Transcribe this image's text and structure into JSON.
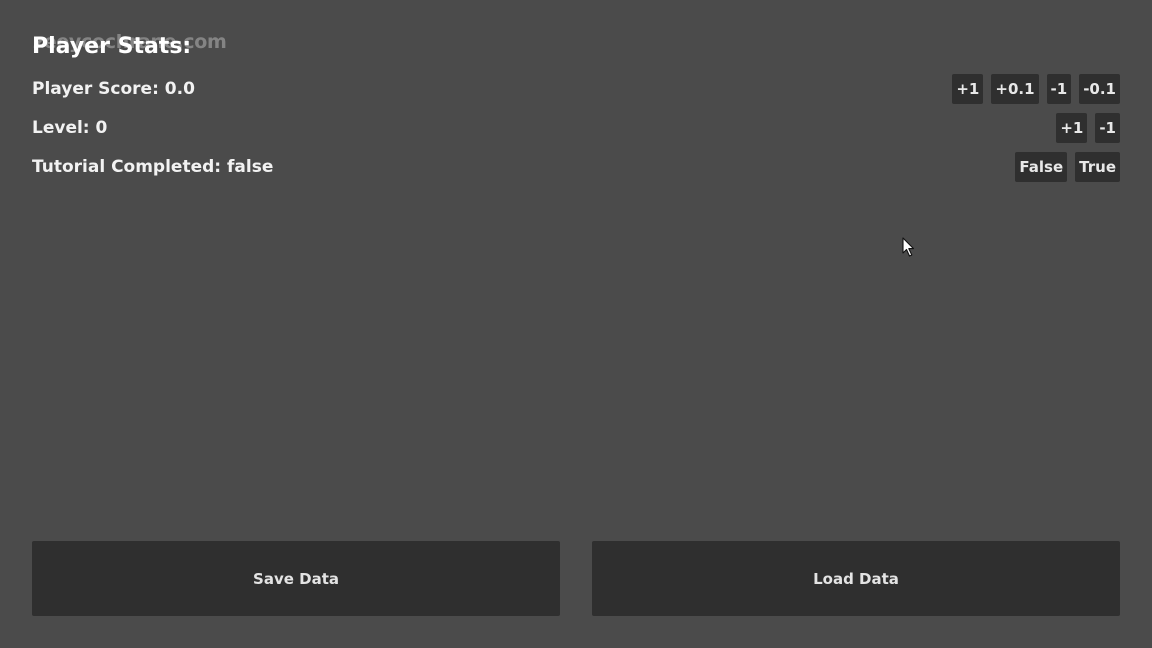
{
  "watermark": "zeeycochrane.com",
  "title": "Player Stats:",
  "stats": {
    "score": {
      "label": "Player Score: 0.0",
      "buttons": [
        "+1",
        "+0.1",
        "-1",
        "-0.1"
      ]
    },
    "level": {
      "label": "Level: 0",
      "buttons": [
        "+1",
        "-1"
      ]
    },
    "tutorial": {
      "label": "Tutorial Completed: false",
      "buttons": [
        "False",
        "True"
      ]
    }
  },
  "actions": {
    "save_label": "Save Data",
    "load_label": "Load Data"
  },
  "colors": {
    "background": "#4b4b4b",
    "button": "#2f2f2f",
    "text": "#f0f0f0"
  },
  "icons": {
    "cursor": "mouse-pointer-icon"
  }
}
